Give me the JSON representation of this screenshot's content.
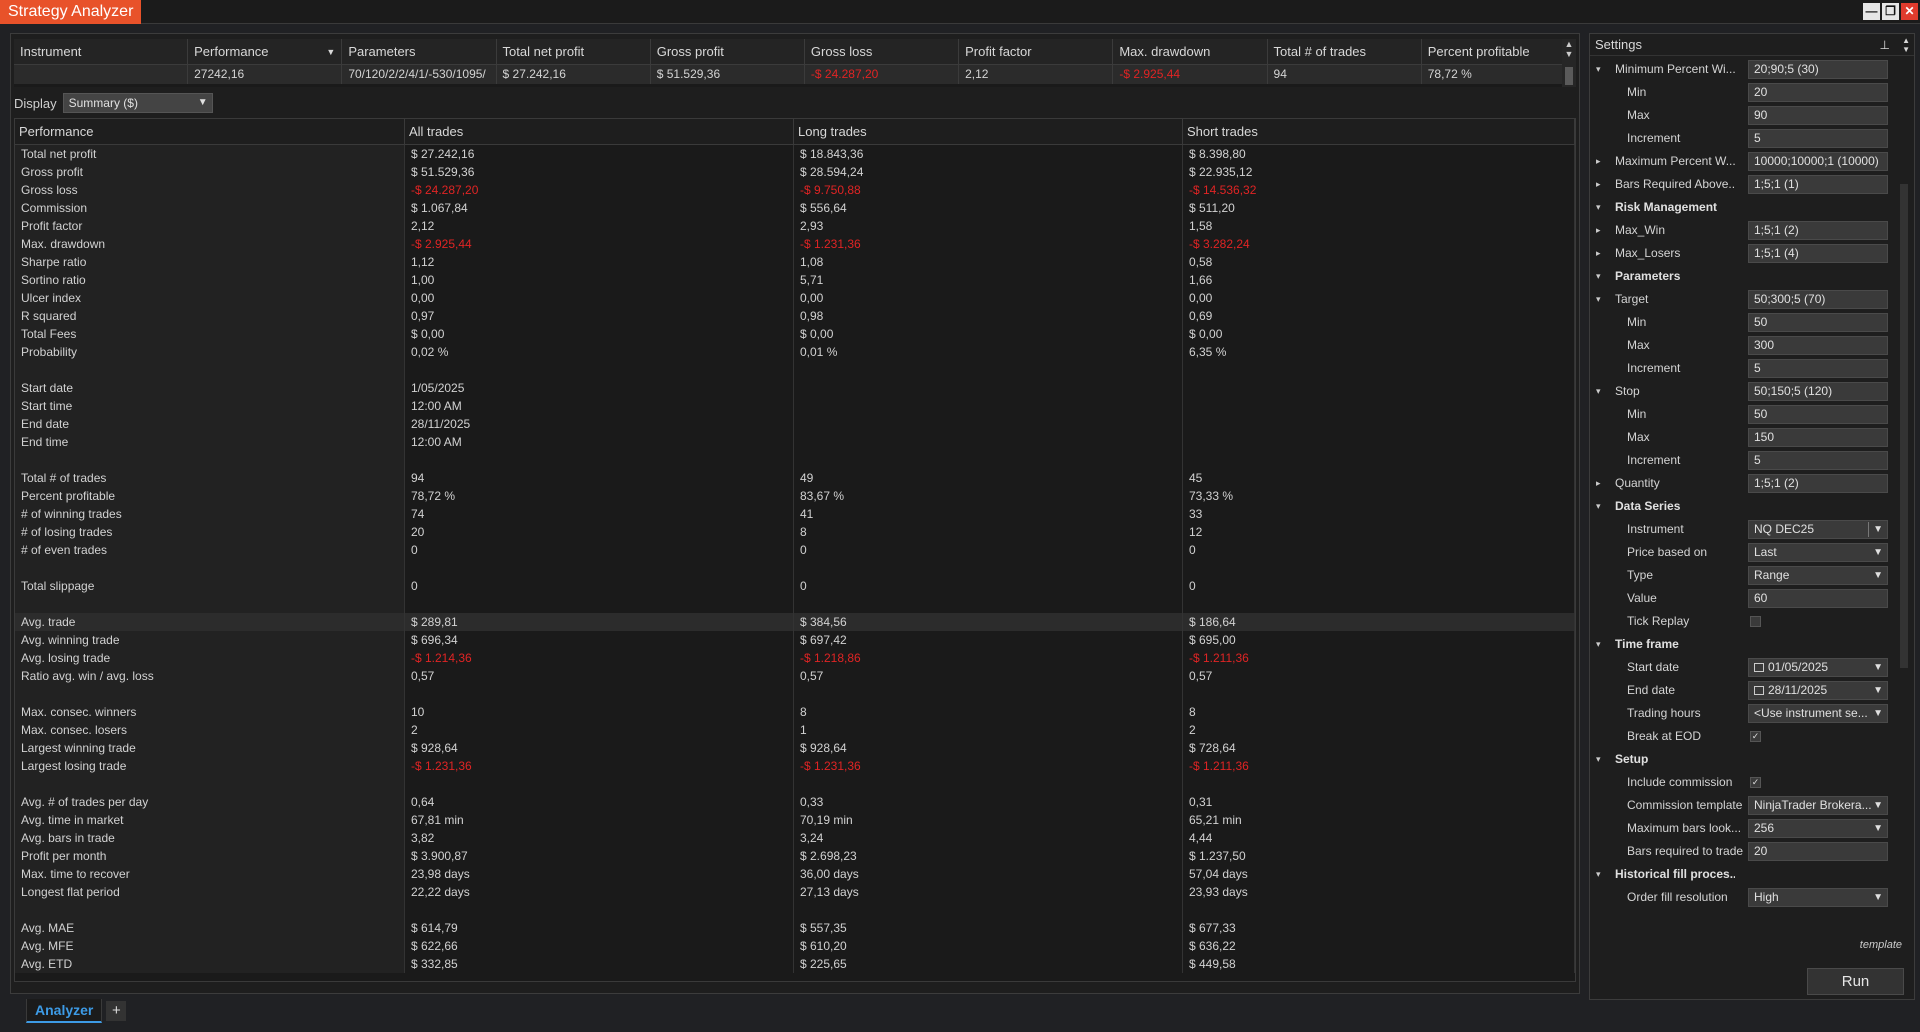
{
  "app": {
    "title": "Strategy Analyzer",
    "win_minimize": "—",
    "win_restore": "❐",
    "win_close": "✕"
  },
  "results": {
    "headers": [
      "Instrument",
      "Performance",
      "Parameters",
      "Total net profit",
      "Gross profit",
      "Gross loss",
      "Profit factor",
      "Max. drawdown",
      "Total # of trades",
      "Percent profitable"
    ],
    "row": [
      "",
      "27242,16",
      "70/120/2/2/4/1/-530/1095/",
      "$ 27.242,16",
      "$ 51.529,36",
      "-$ 24.287,20",
      "2,12",
      "-$ 2.925,44",
      "94",
      "78,72 %"
    ]
  },
  "display": {
    "label": "Display",
    "selected": "Summary ($)"
  },
  "summary": {
    "headers": [
      "Performance",
      "All trades",
      "Long trades",
      "Short trades"
    ],
    "rows": [
      [
        "Total net profit",
        "$ 27.242,16",
        "$ 18.843,36",
        "$ 8.398,80"
      ],
      [
        "Gross profit",
        "$ 51.529,36",
        "$ 28.594,24",
        "$ 22.935,12"
      ],
      [
        "Gross loss",
        "-$ 24.287,20",
        "-$ 9.750,88",
        "-$ 14.536,32"
      ],
      [
        "Commission",
        "$ 1.067,84",
        "$ 556,64",
        "$ 511,20"
      ],
      [
        "Profit factor",
        "2,12",
        "2,93",
        "1,58"
      ],
      [
        "Max. drawdown",
        "-$ 2.925,44",
        "-$ 1.231,36",
        "-$ 3.282,24"
      ],
      [
        "Sharpe ratio",
        "1,12",
        "1,08",
        "0,58"
      ],
      [
        "Sortino ratio",
        "1,00",
        "5,71",
        "1,66"
      ],
      [
        "Ulcer index",
        "0,00",
        "0,00",
        "0,00"
      ],
      [
        "R squared",
        "0,97",
        "0,98",
        "0,69"
      ],
      [
        "Total Fees",
        "$ 0,00",
        "$ 0,00",
        "$ 0,00"
      ],
      [
        "Probability",
        "0,02 %",
        "0,01 %",
        "6,35 %"
      ],
      [
        "",
        "",
        "",
        ""
      ],
      [
        "Start date",
        "1/05/2025",
        "",
        ""
      ],
      [
        "Start time",
        "12:00 AM",
        "",
        ""
      ],
      [
        "End date",
        "28/11/2025",
        "",
        ""
      ],
      [
        "End time",
        "12:00 AM",
        "",
        ""
      ],
      [
        "",
        "",
        "",
        ""
      ],
      [
        "Total # of trades",
        "94",
        "49",
        "45"
      ],
      [
        "Percent profitable",
        "78,72 %",
        "83,67 %",
        "73,33 %"
      ],
      [
        "# of winning trades",
        "74",
        "41",
        "33"
      ],
      [
        "# of losing trades",
        "20",
        "8",
        "12"
      ],
      [
        "# of even trades",
        "0",
        "0",
        "0"
      ],
      [
        "",
        "",
        "",
        ""
      ],
      [
        "Total slippage",
        "0",
        "0",
        "0"
      ],
      [
        "",
        "",
        "",
        ""
      ],
      [
        "Avg. trade",
        "$ 289,81",
        "$ 384,56",
        "$ 186,64"
      ],
      [
        "Avg. winning trade",
        "$ 696,34",
        "$ 697,42",
        "$ 695,00"
      ],
      [
        "Avg. losing trade",
        "-$ 1.214,36",
        "-$ 1.218,86",
        "-$ 1.211,36"
      ],
      [
        "Ratio avg. win / avg. loss",
        "0,57",
        "0,57",
        "0,57"
      ],
      [
        "",
        "",
        "",
        ""
      ],
      [
        "Max. consec. winners",
        "10",
        "8",
        "8"
      ],
      [
        "Max. consec. losers",
        "2",
        "1",
        "2"
      ],
      [
        "Largest winning trade",
        "$ 928,64",
        "$ 928,64",
        "$ 728,64"
      ],
      [
        "Largest losing trade",
        "-$ 1.231,36",
        "-$ 1.231,36",
        "-$ 1.211,36"
      ],
      [
        "",
        "",
        "",
        ""
      ],
      [
        "Avg. # of trades per day",
        "0,64",
        "0,33",
        "0,31"
      ],
      [
        "Avg. time in market",
        "67,81 min",
        "70,19 min",
        "65,21 min"
      ],
      [
        "Avg. bars in trade",
        "3,82",
        "3,24",
        "4,44"
      ],
      [
        "Profit per month",
        "$ 3.900,87",
        "$ 2.698,23",
        "$ 1.237,50"
      ],
      [
        "Max. time to recover",
        "23,98 days",
        "36,00 days",
        "57,04 days"
      ],
      [
        "Longest flat period",
        "22,22 days",
        "27,13 days",
        "23,93 days"
      ],
      [
        "",
        "",
        "",
        ""
      ],
      [
        "Avg. MAE",
        "$ 614,79",
        "$ 557,35",
        "$ 677,33"
      ],
      [
        "Avg. MFE",
        "$ 622,66",
        "$ 610,20",
        "$ 636,22"
      ],
      [
        "Avg. ETD",
        "$ 332,85",
        "$ 225,65",
        "$ 449,58"
      ]
    ],
    "highlight_row": "Avg. trade"
  },
  "tabs": {
    "active": "Analyzer",
    "add": "+"
  },
  "settings": {
    "title": "Settings",
    "pin_icon": "pin-icon",
    "items": [
      {
        "level": 1,
        "expander": "▾",
        "label": "Minimum Percent Wi...",
        "value": "20;90;5 (30)"
      },
      {
        "level": 2,
        "label": "Min",
        "value": "20"
      },
      {
        "level": 2,
        "label": "Max",
        "value": "90"
      },
      {
        "level": 2,
        "label": "Increment",
        "value": "5"
      },
      {
        "level": 1,
        "expander": "▸",
        "label": "Maximum Percent W...",
        "value": "10000;10000;1 (10000)"
      },
      {
        "level": 1,
        "expander": "▸",
        "label": "Bars Required Above...",
        "value": "1;5;1 (1)"
      },
      {
        "level": 0,
        "expander": "▾",
        "label": "Risk Management",
        "category": true
      },
      {
        "level": 1,
        "expander": "▸",
        "label": "Max_Win",
        "value": "1;5;1 (2)"
      },
      {
        "level": 1,
        "expander": "▸",
        "label": "Max_Losers",
        "value": "1;5;1 (4)"
      },
      {
        "level": 0,
        "expander": "▾",
        "label": "Parameters",
        "category": true
      },
      {
        "level": 1,
        "expander": "▾",
        "label": "Target",
        "value": "50;300;5 (70)"
      },
      {
        "level": 2,
        "label": "Min",
        "value": "50"
      },
      {
        "level": 2,
        "label": "Max",
        "value": "300"
      },
      {
        "level": 2,
        "label": "Increment",
        "value": "5"
      },
      {
        "level": 1,
        "expander": "▾",
        "label": "Stop",
        "value": "50;150;5 (120)"
      },
      {
        "level": 2,
        "label": "Min",
        "value": "50"
      },
      {
        "level": 2,
        "label": "Max",
        "value": "150"
      },
      {
        "level": 2,
        "label": "Increment",
        "value": "5"
      },
      {
        "level": 1,
        "expander": "▸",
        "label": "Quantity",
        "value": "1;5;1 (2)"
      },
      {
        "level": 0,
        "expander": "▾",
        "label": "Data Series",
        "category": true
      },
      {
        "level": 2,
        "label": "Instrument",
        "value": "NQ DEC25",
        "dropdown": true,
        "sep": true
      },
      {
        "level": 2,
        "label": "Price based on",
        "value": "Last",
        "dropdown": true
      },
      {
        "level": 2,
        "label": "Type",
        "value": "Range",
        "dropdown": true
      },
      {
        "level": 2,
        "label": "Value",
        "value": "60"
      },
      {
        "level": 2,
        "label": "Tick Replay",
        "checkbox": true,
        "checked": false
      },
      {
        "level": 0,
        "expander": "▾",
        "label": "Time frame",
        "category": true
      },
      {
        "level": 2,
        "label": "Start date",
        "value": "01/05/2025",
        "dropdown": true,
        "calendar": true
      },
      {
        "level": 2,
        "label": "End date",
        "value": "28/11/2025",
        "dropdown": true,
        "calendar": true
      },
      {
        "level": 2,
        "label": "Trading hours",
        "value": "<Use instrument se...",
        "dropdown": true
      },
      {
        "level": 2,
        "label": "Break at EOD",
        "checkbox": true,
        "checked": true
      },
      {
        "level": 0,
        "expander": "▾",
        "label": "Setup",
        "category": true
      },
      {
        "level": 2,
        "label": "Include commission",
        "checkbox": true,
        "checked": true
      },
      {
        "level": 2,
        "label": "Commission template",
        "value": "NinjaTrader Brokera...",
        "dropdown": true
      },
      {
        "level": 2,
        "label": "Maximum bars look...",
        "value": "256",
        "dropdown": true
      },
      {
        "level": 2,
        "label": "Bars required to trade",
        "value": "20"
      },
      {
        "level": 0,
        "expander": "▾",
        "label": "Historical fill proces...",
        "category": true
      },
      {
        "level": 2,
        "label": "Order fill resolution",
        "value": "High",
        "dropdown": true
      }
    ],
    "template_label": "template",
    "run_label": "Run"
  },
  "colors": {
    "accent": "#e8522a",
    "negative": "#e02424",
    "tab_active": "#3d9be6"
  }
}
